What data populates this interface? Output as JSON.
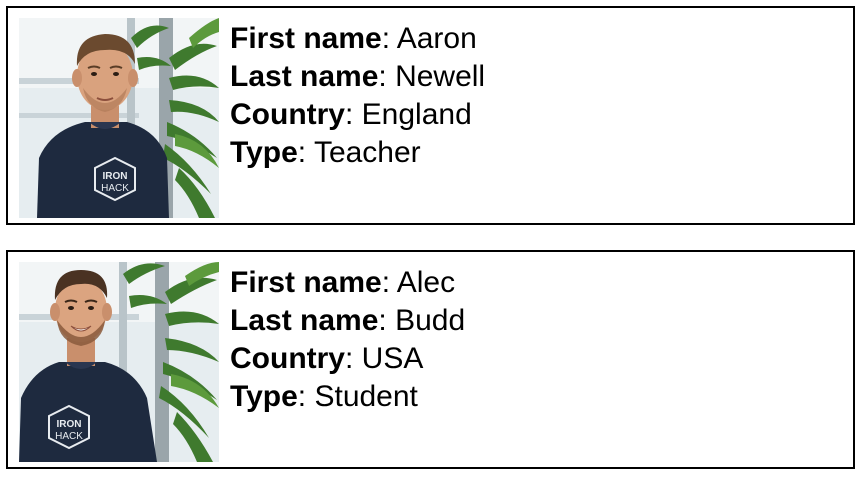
{
  "cards": [
    {
      "photo": "person-photo",
      "fields": [
        {
          "label": "First name",
          "separator": ": ",
          "value": "Aaron"
        },
        {
          "label": "Last name",
          "separator": ": ",
          "value": "Newell"
        },
        {
          "label": "Country",
          "separator": ": ",
          "value": "England"
        },
        {
          "label": "Type",
          "separator": ": ",
          "value": "Teacher"
        }
      ],
      "shirt_logo": {
        "line1": "IRON",
        "line2": "HACK"
      }
    },
    {
      "photo": "person-photo",
      "fields": [
        {
          "label": "First name",
          "separator": ": ",
          "value": "Alec"
        },
        {
          "label": "Last name",
          "separator": ": ",
          "value": "Budd"
        },
        {
          "label": "Country",
          "separator": ": ",
          "value": "USA"
        },
        {
          "label": "Type",
          "separator": ": ",
          "value": "Student"
        }
      ],
      "shirt_logo": {
        "line1": "IRON",
        "line2": "HACK"
      }
    }
  ],
  "colors": {
    "border": "#000000",
    "shirt": "#1e2a3f",
    "skin": "#d9a27e",
    "hair_1": "#6b4a2f",
    "hair_2": "#4a3222",
    "window_light": "#e6edf0",
    "plant_green": "#3f7a2e"
  }
}
